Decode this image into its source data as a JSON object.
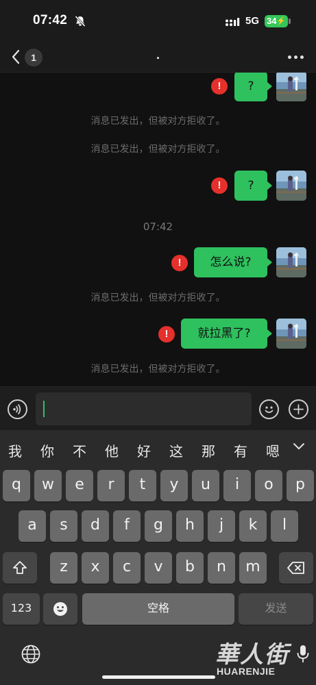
{
  "status_bar": {
    "time": "07:42",
    "network": "5G",
    "battery": "34",
    "icons": [
      "bell-slash-icon",
      "signal-icon",
      "battery-charging-icon"
    ]
  },
  "nav": {
    "back_badge": "1",
    "title": ".",
    "icons": [
      "chevron-left-icon",
      "more-icon"
    ]
  },
  "chat": {
    "messages": [
      {
        "type": "bubble",
        "text": "?",
        "failed": true
      },
      {
        "type": "system",
        "text": "消息已发出，但被对方拒收了。"
      },
      {
        "type": "system",
        "text": "消息已发出，但被对方拒收了。"
      },
      {
        "type": "bubble",
        "text": "?",
        "failed": true
      },
      {
        "type": "time",
        "text": "07:42"
      },
      {
        "type": "bubble",
        "text": "怎么说?",
        "failed": true
      },
      {
        "type": "system",
        "text": "消息已发出，但被对方拒收了。"
      },
      {
        "type": "bubble",
        "text": "就拉黑了?",
        "failed": true
      },
      {
        "type": "system",
        "text": "消息已发出，但被对方拒收了。"
      }
    ],
    "error_mark": "!"
  },
  "input_bar": {
    "value": "",
    "icons": [
      "voice-icon",
      "emoji-icon",
      "plus-icon"
    ]
  },
  "keyboard": {
    "candidates": [
      "我",
      "你",
      "不",
      "他",
      "好",
      "这",
      "那",
      "有",
      "嗯"
    ],
    "row1": [
      "q",
      "w",
      "e",
      "r",
      "t",
      "y",
      "u",
      "i",
      "o",
      "p"
    ],
    "row2": [
      "a",
      "s",
      "d",
      "f",
      "g",
      "h",
      "j",
      "k",
      "l"
    ],
    "row3": [
      "z",
      "x",
      "c",
      "v",
      "b",
      "n",
      "m"
    ],
    "numbers_key": "123",
    "space_key": "空格",
    "send_key": "发送",
    "icons": [
      "shift-icon",
      "delete-icon",
      "emoji-icon",
      "globe-icon",
      "mic-icon",
      "chevron-down-icon"
    ]
  },
  "watermark": {
    "cn": "華人街",
    "en": "HUARENJIE"
  },
  "colors": {
    "bubble": "#2ec15e",
    "error": "#e5302c",
    "background": "#111111"
  }
}
